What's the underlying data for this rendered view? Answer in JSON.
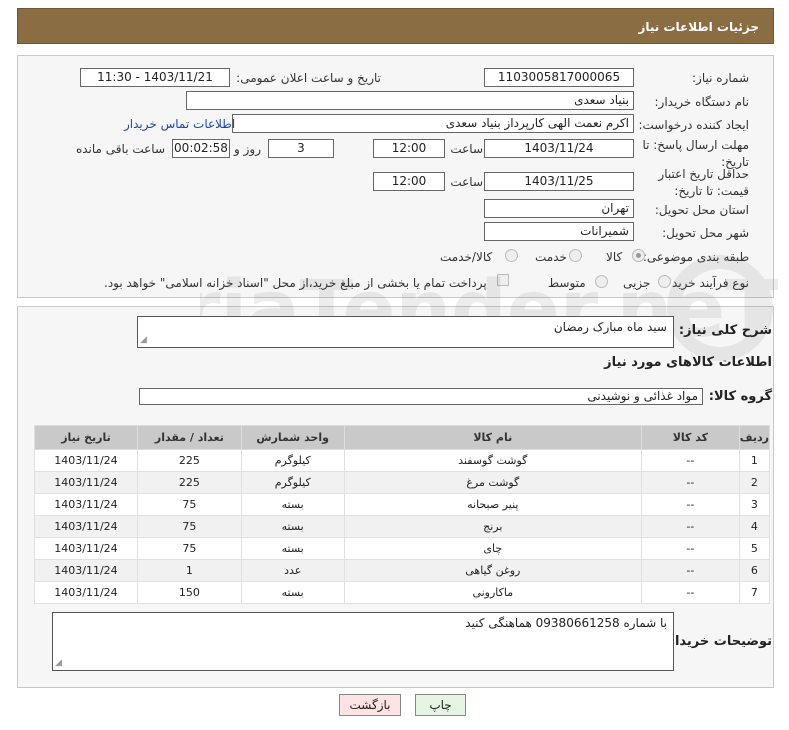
{
  "header": {
    "title": "جزئیات اطلاعات نیاز"
  },
  "form": {
    "need_number_label": "شماره نیاز:",
    "need_number": "1103005817000065",
    "announce_label": "تاریخ و ساعت اعلان عمومی:",
    "announce_value": "1403/11/21 - 11:30",
    "buyer_org_label": "نام دستگاه خریدار:",
    "buyer_org": "بنیاد سعدی",
    "creator_label": "ایجاد کننده درخواست:",
    "creator": "اکرم نعمت الهی کارپرداز بنیاد سعدی",
    "contact_link": "اطلاعات تماس خریدار",
    "reply_deadline_label": "مهلت ارسال پاسخ: تا تاریخ:",
    "reply_date": "1403/11/24",
    "time_label": "ساعت",
    "reply_time": "12:00",
    "days_value": "3",
    "days_label": "روز و",
    "remaining_value": "00:02:58",
    "remaining_label": "ساعت باقی مانده",
    "price_validity_label": "حداقل تاریخ اعتبار قیمت: تا تاریخ:",
    "price_date": "1403/11/25",
    "price_time": "12:00",
    "province_label": "استان محل تحویل:",
    "province": "تهران",
    "city_label": "شهر محل تحویل:",
    "city": "شمیرانات",
    "category_label": "طبقه بندی موضوعی:",
    "category_options": [
      "کالا",
      "خدمت",
      "کالا/خدمت"
    ],
    "category_selected": "کالا",
    "process_label": "نوع فرآیند خرید :",
    "process_options": [
      "جزیی",
      "متوسط"
    ],
    "process_selected": "جزیی",
    "payment_note": "پرداخت تمام یا بخشی از مبلغ خرید،از محل \"اسناد خزانه اسلامی\" خواهد بود."
  },
  "details": {
    "summary_label": "شرح کلی نیاز:",
    "summary_value": "سبد ماه مبارک رمضان",
    "items_heading": "اطلاعات کالاهای مورد نیاز",
    "group_label": "گروه کالا:",
    "group_value": "مواد غذائی و نوشیدنی",
    "table": {
      "headers": [
        "ردیف",
        "کد کالا",
        "نام کالا",
        "واحد شمارش",
        "تعداد / مقدار",
        "تاریخ نیاز"
      ],
      "rows": [
        [
          "1",
          "--",
          "گوشت گوسفند",
          "کیلوگرم",
          "225",
          "1403/11/24"
        ],
        [
          "2",
          "--",
          "گوشت مرغ",
          "کیلوگرم",
          "225",
          "1403/11/24"
        ],
        [
          "3",
          "--",
          "پنیر صبحانه",
          "بسته",
          "75",
          "1403/11/24"
        ],
        [
          "4",
          "--",
          "برنج",
          "بسته",
          "75",
          "1403/11/24"
        ],
        [
          "5",
          "--",
          "چای",
          "بسته",
          "75",
          "1403/11/24"
        ],
        [
          "6",
          "--",
          "روغن گیاهی",
          "عدد",
          "1",
          "1403/11/24"
        ],
        [
          "7",
          "--",
          "ماکارونی",
          "بسته",
          "150",
          "1403/11/24"
        ]
      ]
    },
    "buyer_notes_label": "توضیحات خریدار:",
    "buyer_notes_value": "با شماره 09380661258 هماهنگی کنید"
  },
  "buttons": {
    "print": "چاپ",
    "back": "بازگشت"
  },
  "watermark": {
    "text": "AriaTender.neT"
  },
  "colors": {
    "header": "#8a6d42",
    "table_header": "#c9c9c9",
    "back_button": "#fde3e3",
    "print_button": "#e6f5e3"
  }
}
